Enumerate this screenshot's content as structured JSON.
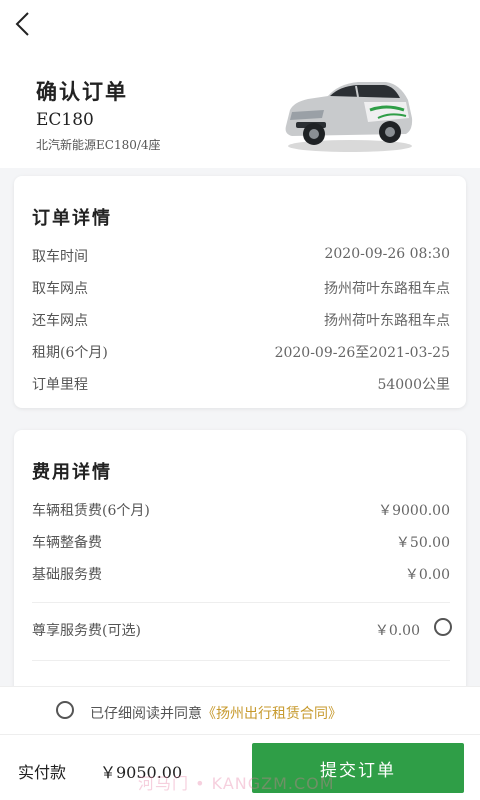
{
  "header": {
    "title": "确认订单",
    "model": "EC180",
    "model_desc": "北汽新能源EC180/4座"
  },
  "order_details": {
    "title": "订单详情",
    "rows": [
      {
        "label": "取车时间",
        "value": "2020-09-26  08:30"
      },
      {
        "label": "取车网点",
        "value": "扬州荷叶东路租车点"
      },
      {
        "label": "还车网点",
        "value": "扬州荷叶东路租车点"
      },
      {
        "label": "租期(6个月)",
        "value": "2020-09-26至2021-03-25"
      },
      {
        "label": "订单里程",
        "value": "54000公里"
      }
    ]
  },
  "fee_details": {
    "title": "费用详情",
    "rows": [
      {
        "label": "车辆租赁费(6个月)",
        "value": "￥9000.00"
      },
      {
        "label": "车辆整备费",
        "value": "￥50.00"
      },
      {
        "label": "基础服务费",
        "value": "￥0.00"
      }
    ],
    "optional": {
      "label": "尊享服务费(可选)",
      "value": "￥0.00",
      "selected": false
    }
  },
  "agreement": {
    "prefix": "已仔细阅读并同意",
    "contract": "《扬州出行租赁合同》",
    "checked": false
  },
  "footer": {
    "pay_label": "实付款",
    "pay_amount": "￥9050.00",
    "submit_label": "提交订单",
    "watermark": "河马门 • KANGZM.COM"
  },
  "colors": {
    "accent_green": "#2f9e47",
    "contract_gold": "#c79a2e"
  },
  "icons": {
    "back": "chevron-left-icon",
    "car": "car-image"
  }
}
